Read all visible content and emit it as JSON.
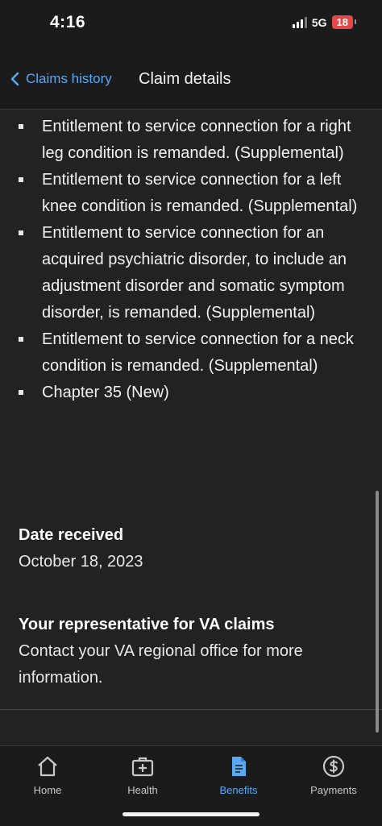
{
  "status": {
    "time": "4:16",
    "network": "5G",
    "battery": "18"
  },
  "nav": {
    "back_label": "Claims history",
    "title": "Claim details"
  },
  "issues": [
    "Entitlement to service connection for a right leg condition is remanded. (Supplemental)",
    "Entitlement to service connection for a left knee condition is remanded. (Supplemental)",
    "Entitlement to service connection for an acquired psychiatric disorder, to include an adjustment disorder and somatic symptom disorder, is remanded. (Supplemental)",
    "Entitlement to service connection for a neck condition is remanded. (Supplemental)",
    "Chapter 35 (New)"
  ],
  "date_received": {
    "title": "Date received",
    "value": "October 18, 2023"
  },
  "representative": {
    "title": "Your representative for VA claims",
    "body": "Contact your VA regional office for more information."
  },
  "tabs": [
    {
      "label": "Home",
      "icon": "home-icon"
    },
    {
      "label": "Health",
      "icon": "medical-kit-icon"
    },
    {
      "label": "Benefits",
      "icon": "document-icon",
      "active": true
    },
    {
      "label": "Payments",
      "icon": "dollar-icon"
    }
  ],
  "colors": {
    "accent": "#5aa8f2",
    "background": "#222222",
    "bar": "#1b1b1b"
  }
}
